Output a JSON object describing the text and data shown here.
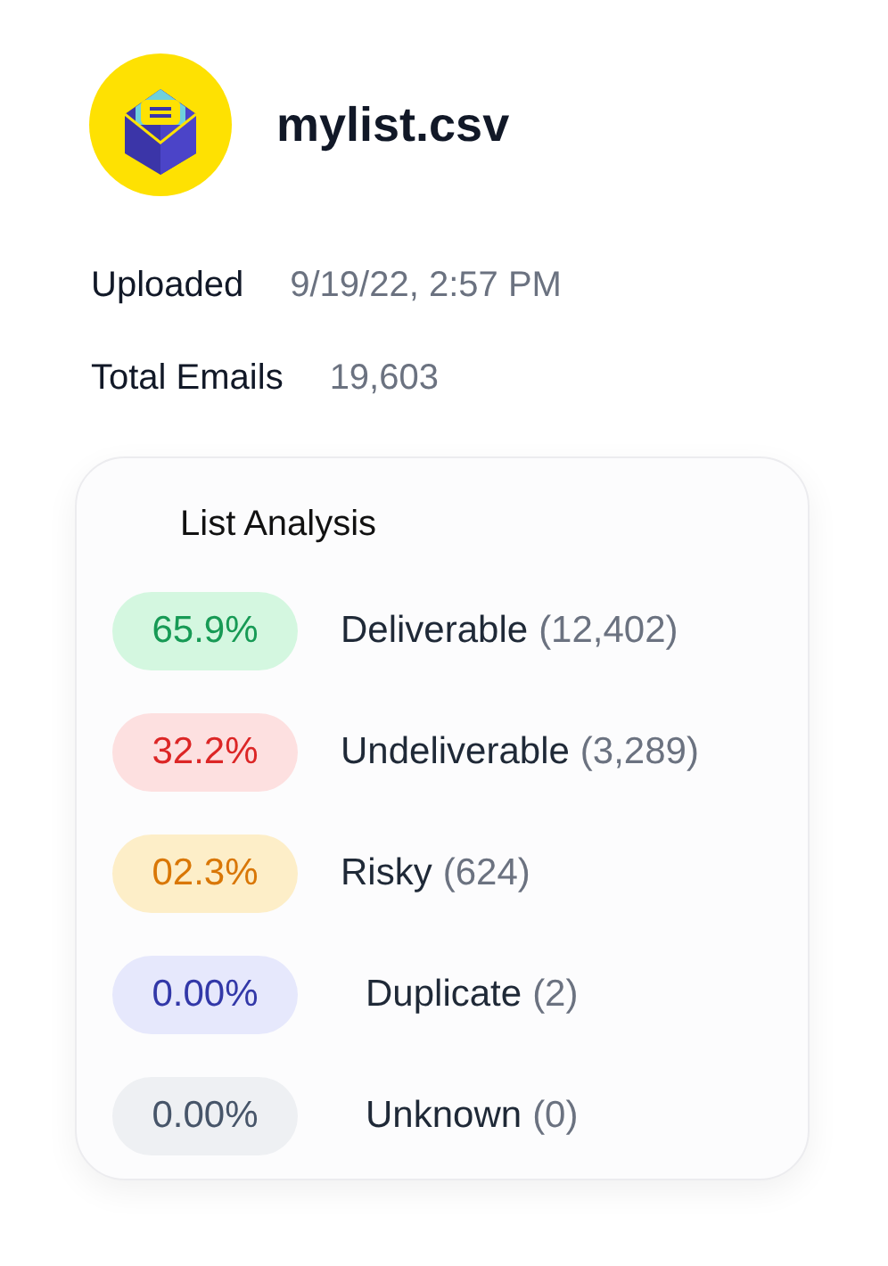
{
  "file": {
    "name": "mylist.csv"
  },
  "details": [
    {
      "label": "Uploaded",
      "value": "9/19/22, 2:57 PM"
    },
    {
      "label": "Total Emails",
      "value": "19,603"
    }
  ],
  "analysis": {
    "title": "List Analysis",
    "rows": [
      {
        "kind": "deliverable",
        "percent": "65.9%",
        "label": "Deliverable",
        "count": "(12,402)"
      },
      {
        "kind": "undeliverable",
        "percent": "32.2%",
        "label": "Undeliverable",
        "count": "(3,289)"
      },
      {
        "kind": "risky",
        "percent": "02.3%",
        "label": "Risky",
        "count": "(624)"
      },
      {
        "kind": "duplicate",
        "percent": "0.00%",
        "label": "Duplicate",
        "count": "(2)"
      },
      {
        "kind": "unknown",
        "percent": "0.00%",
        "label": "Unknown",
        "count": "(0)"
      }
    ]
  }
}
